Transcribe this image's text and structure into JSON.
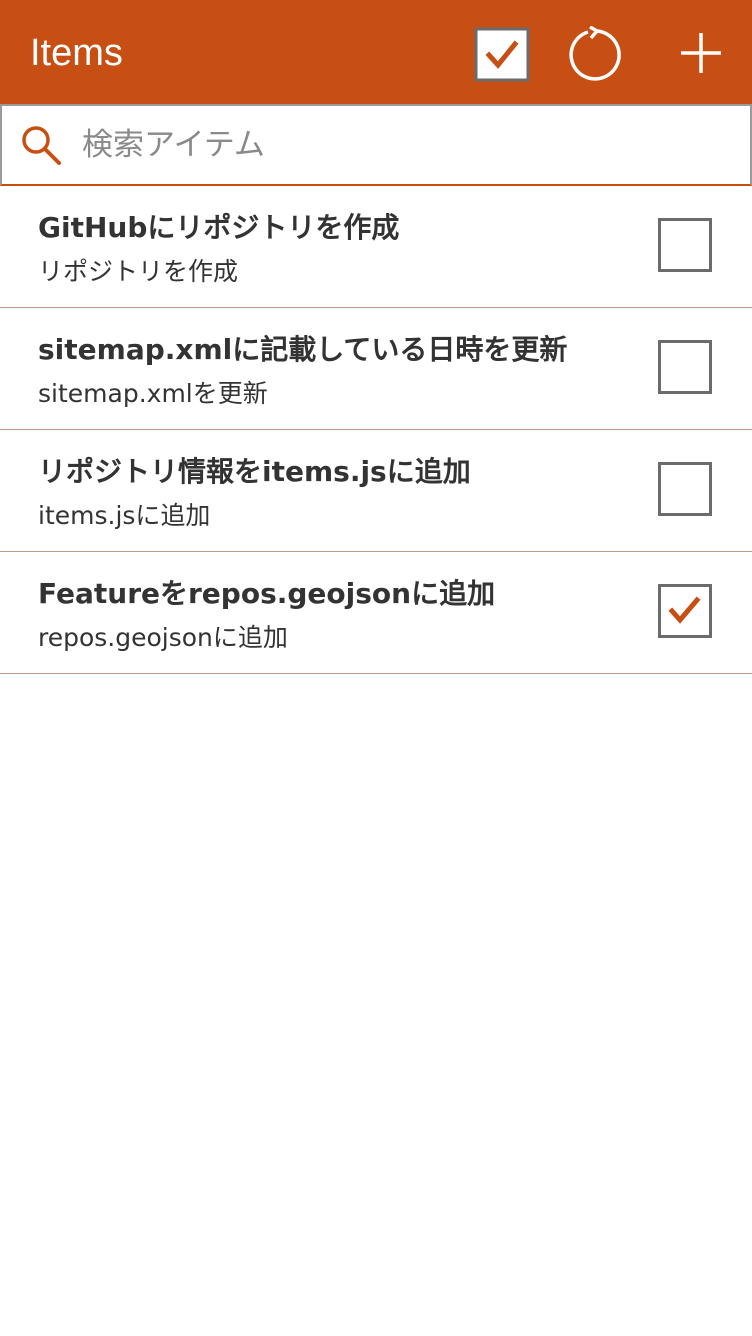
{
  "header": {
    "title": "Items",
    "select_all_icon": "checkbox-checked-icon",
    "refresh_icon": "refresh-icon",
    "add_icon": "plus-icon"
  },
  "search": {
    "placeholder": "検索アイテム",
    "value": "",
    "icon": "search-icon"
  },
  "items": [
    {
      "title": "GitHubにリポジトリを作成",
      "subtitle": "リポジトリを作成",
      "checked": false
    },
    {
      "title": "sitemap.xmlに記載している日時を更新",
      "subtitle": "sitemap.xmlを更新",
      "checked": false
    },
    {
      "title": "リポジトリ情報をitems.jsに追加",
      "subtitle": "items.jsに追加",
      "checked": false
    },
    {
      "title": "Featureをrepos.geojsonに追加",
      "subtitle": "repos.geojsonに追加",
      "checked": true
    }
  ],
  "colors": {
    "accent": "#c84f13",
    "text": "#333333",
    "divider": "#c49a88",
    "checkbox_border": "#6b6b6b"
  }
}
